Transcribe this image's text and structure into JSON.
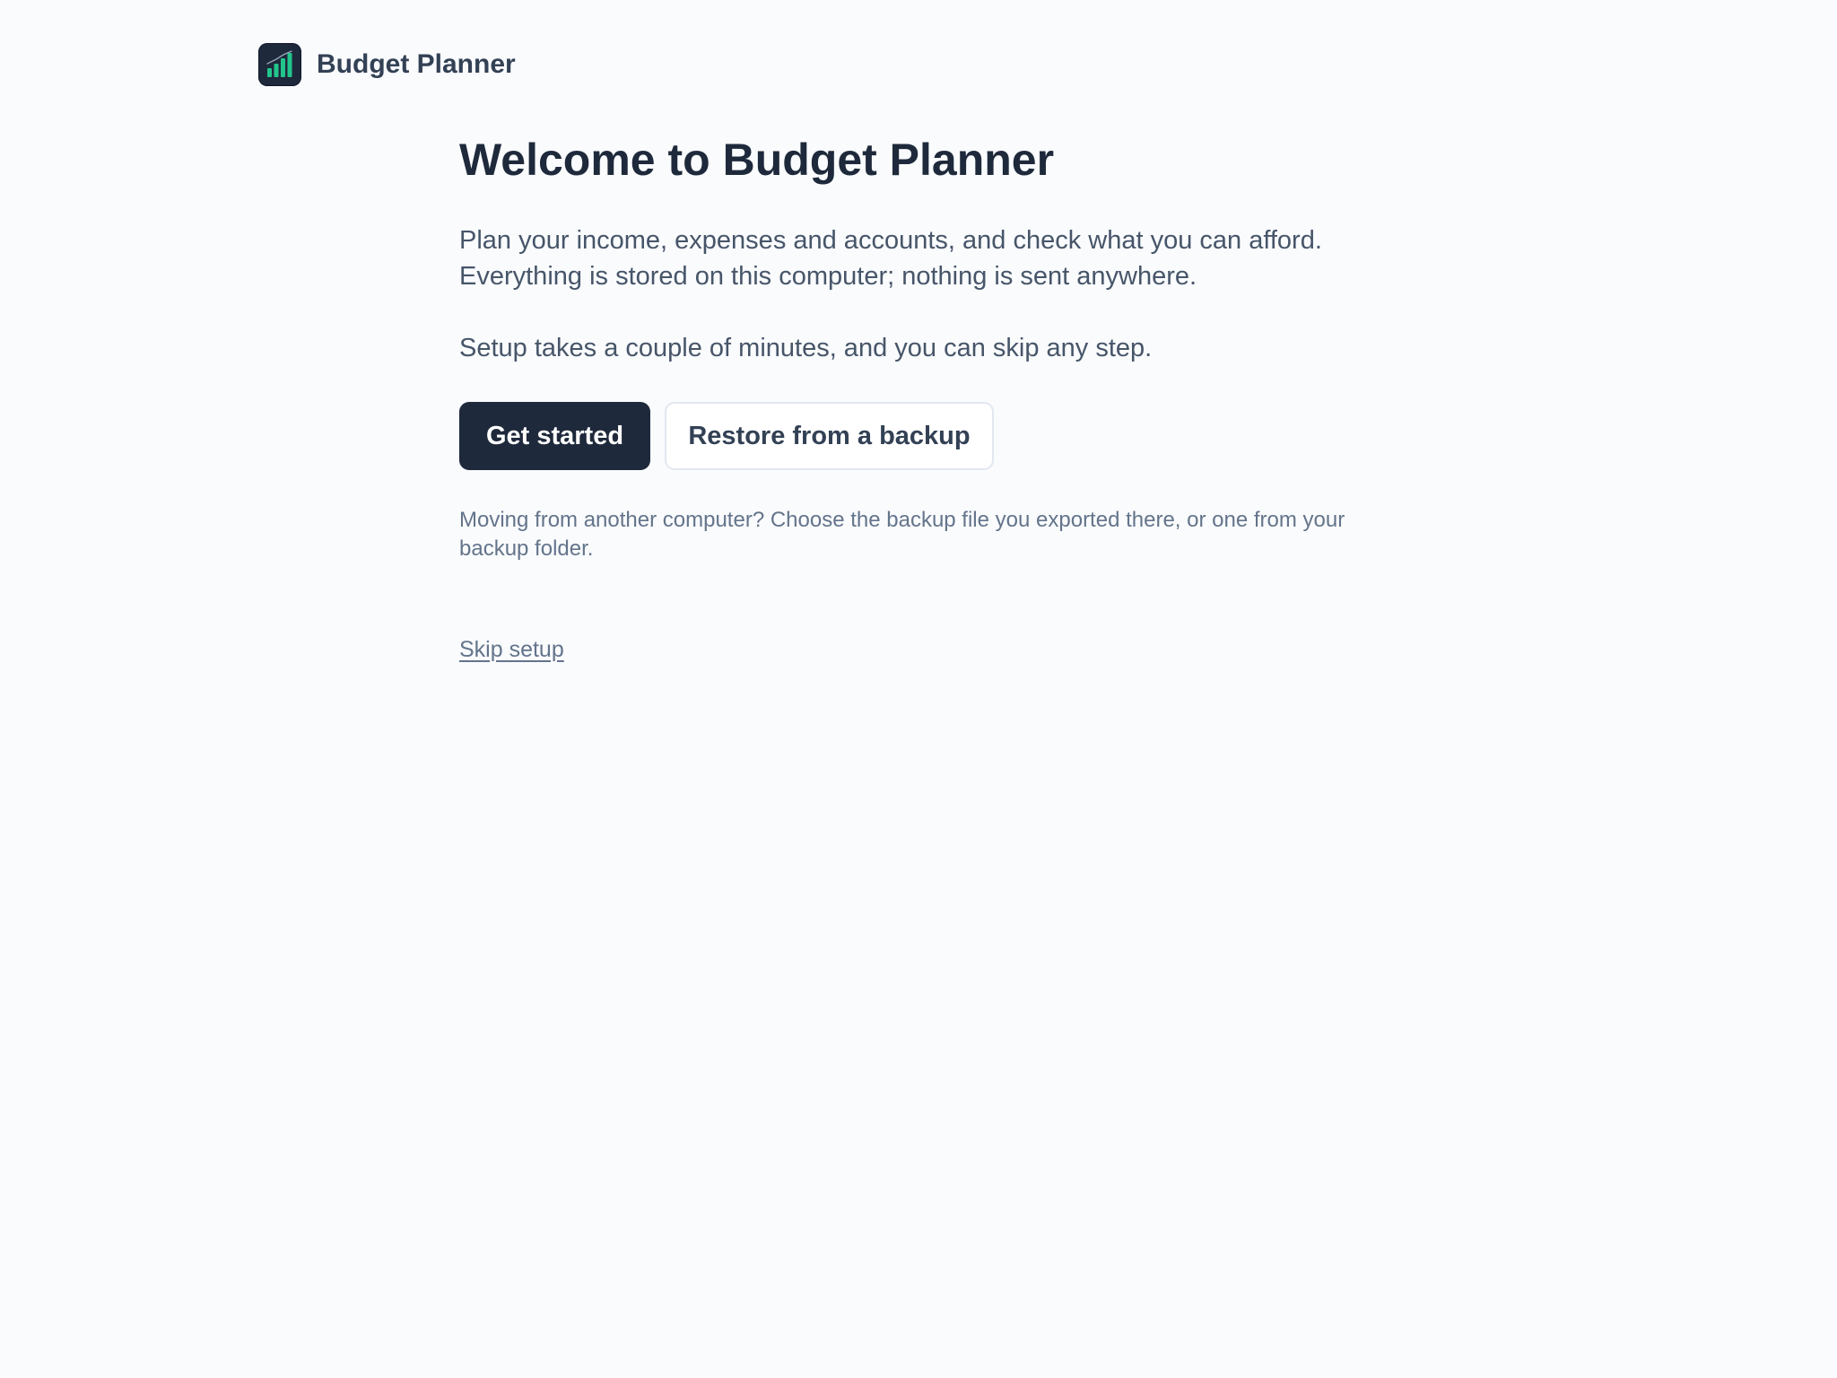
{
  "header": {
    "app_name": "Budget Planner",
    "app_icon": "bar-chart-icon"
  },
  "welcome": {
    "title": "Welcome to Budget Planner",
    "intro_line_1": "Plan your income, expenses and accounts, and check what you can afford.",
    "intro_line_2": "Everything is stored on this computer; nothing is sent anywhere.",
    "setup_note": "Setup takes a couple of minutes, and you can skip any step.",
    "primary_button": "Get started",
    "secondary_button": "Restore from a backup",
    "backup_hint": "Moving from another computer? Choose the backup file you exported there, or one from your backup folder.",
    "skip_link": "Skip setup"
  },
  "colors": {
    "background": "#f9fbfd",
    "primary": "#1e293b",
    "accent_green": "#22c58b",
    "muted_text": "#64748b",
    "body_text": "#475569"
  }
}
